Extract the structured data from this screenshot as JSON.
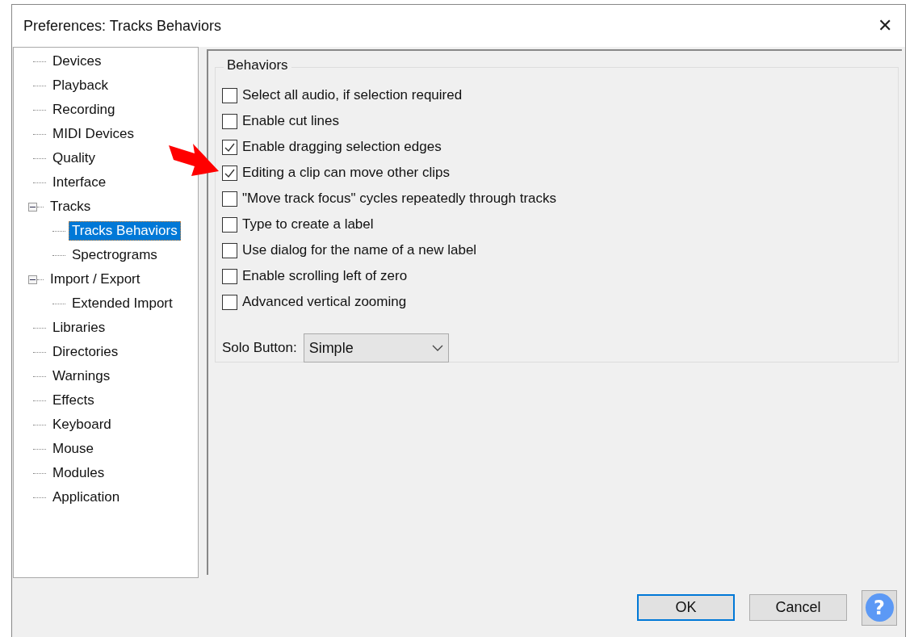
{
  "window": {
    "title": "Preferences: Tracks Behaviors",
    "close_label": "✕"
  },
  "tree": [
    {
      "label": "Devices",
      "selected": false
    },
    {
      "label": "Playback",
      "selected": false
    },
    {
      "label": "Recording",
      "selected": false
    },
    {
      "label": "MIDI Devices",
      "selected": false
    },
    {
      "label": "Quality",
      "selected": false
    },
    {
      "label": "Interface",
      "selected": false
    },
    {
      "label": "Tracks",
      "selected": false,
      "expanded": true,
      "children": [
        {
          "label": "Tracks Behaviors",
          "selected": true
        },
        {
          "label": "Spectrograms",
          "selected": false
        }
      ]
    },
    {
      "label": "Import / Export",
      "selected": false,
      "expanded": true,
      "children": [
        {
          "label": "Extended Import",
          "selected": false
        }
      ]
    },
    {
      "label": "Libraries",
      "selected": false
    },
    {
      "label": "Directories",
      "selected": false
    },
    {
      "label": "Warnings",
      "selected": false
    },
    {
      "label": "Effects",
      "selected": false
    },
    {
      "label": "Keyboard",
      "selected": false
    },
    {
      "label": "Mouse",
      "selected": false
    },
    {
      "label": "Modules",
      "selected": false
    },
    {
      "label": "Application",
      "selected": false
    }
  ],
  "group": {
    "title": "Behaviors",
    "options": [
      {
        "label": "Select all audio, if selection required",
        "checked": false
      },
      {
        "label": "Enable cut lines",
        "checked": false
      },
      {
        "label": "Enable dragging selection edges",
        "checked": true
      },
      {
        "label": "Editing a clip can move other clips",
        "checked": true
      },
      {
        "label": "\"Move track focus\" cycles repeatedly through tracks",
        "checked": false
      },
      {
        "label": "Type to create a label",
        "checked": false
      },
      {
        "label": "Use dialog for the name of a new label",
        "checked": false
      },
      {
        "label": "Enable scrolling left of zero",
        "checked": false
      },
      {
        "label": "Advanced vertical zooming",
        "checked": false
      }
    ],
    "solo": {
      "label": "Solo Button:",
      "value": "Simple"
    }
  },
  "buttons": [
    {
      "label": "OK",
      "default": true
    },
    {
      "label": "Cancel",
      "default": false
    }
  ],
  "help": {
    "label": "?"
  }
}
